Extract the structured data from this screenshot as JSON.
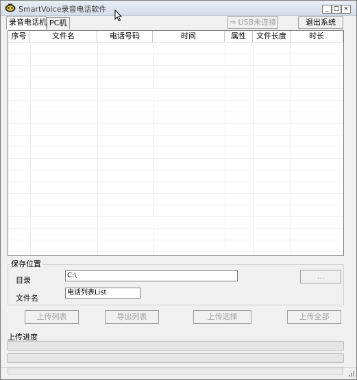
{
  "window": {
    "title": "SmartVoice录音电话软件",
    "controls": {
      "minimize": "_",
      "maximize": "□",
      "close": "×"
    }
  },
  "tabs": [
    {
      "label": "录音电话机",
      "active": true
    },
    {
      "label": "PC机",
      "active": false
    }
  ],
  "toolbar": {
    "usb_status": "⇒ USB未连接",
    "exit_label": "退出系统"
  },
  "table": {
    "columns": [
      "序号",
      "文件名",
      "电话号码",
      "时间",
      "属性",
      "文件长度",
      "时长"
    ],
    "rows": []
  },
  "save_location": {
    "group_title": "保存位置",
    "dir_label": "目录",
    "dir_value": "C:\\",
    "filename_label": "文件名",
    "filename_value": "电话列表List",
    "browse_label": "..."
  },
  "actions": {
    "upload_list": "上传列表",
    "export_list": "导出列表",
    "upload_selected": "上传选择",
    "upload_all": "上传全部"
  },
  "progress": {
    "label": "上传进度",
    "file_progress": 0,
    "total_progress": 0
  },
  "colors": {
    "window_bg": "#f0f0f0",
    "disabled_text": "#a0a0a0",
    "titlebar": "#d5dde9"
  }
}
